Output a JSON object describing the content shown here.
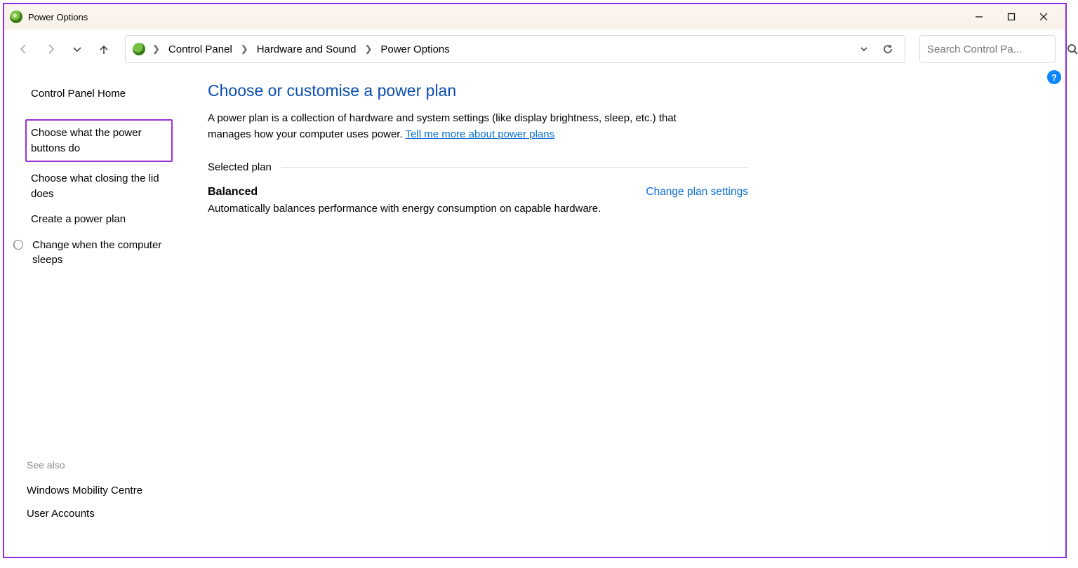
{
  "window": {
    "title": "Power Options"
  },
  "breadcrumb": {
    "root": "Control Panel",
    "mid": "Hardware and Sound",
    "leaf": "Power Options"
  },
  "search": {
    "placeholder": "Search Control Pa..."
  },
  "sidebar": {
    "home": "Control Panel Home",
    "links": {
      "power_buttons": "Choose what the power buttons do",
      "closing_lid": "Choose what closing the lid does",
      "create_plan": "Create a power plan",
      "sleep": "Change when the computer sleeps"
    },
    "see_also_label": "See also",
    "see_also": {
      "mobility": "Windows Mobility Centre",
      "accounts": "User Accounts"
    }
  },
  "main": {
    "title": "Choose or customise a power plan",
    "desc_prefix": "A power plan is a collection of hardware and system settings (like display brightness, sleep, etc.) that manages how your computer uses power. ",
    "desc_link": "Tell me more about power plans",
    "selected_label": "Selected plan",
    "plan": {
      "name": "Balanced",
      "change_link": "Change plan settings",
      "desc": "Automatically balances performance with energy consumption on capable hardware."
    }
  },
  "help_badge": "?"
}
